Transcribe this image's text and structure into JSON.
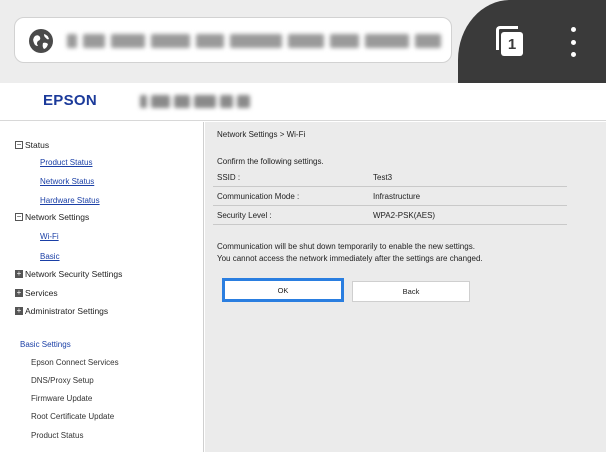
{
  "browser": {
    "tab_count": "1"
  },
  "site": {
    "logo": "EPSON"
  },
  "sidebar": {
    "status": "Status",
    "product_status_link": "Product Status",
    "network_status_link": "Network Status",
    "hardware_status_link": "Hardware Status",
    "network_settings": "Network Settings",
    "wifi_link": "Wi-Fi",
    "basic_link": "Basic",
    "network_security": "Network Security Settings",
    "services": "Services",
    "administrator": "Administrator Settings",
    "basic_settings_heading": "Basic Settings",
    "basic_items": [
      "Epson Connect Services",
      "DNS/Proxy Setup",
      "Firmware Update",
      "Root Certificate Update",
      "Product Status"
    ]
  },
  "main": {
    "breadcrumb": "Network Settings > Wi-Fi",
    "confirm_text": "Confirm the following settings.",
    "settings": [
      {
        "label": "SSID :",
        "value": "Test3"
      },
      {
        "label": "Communication Mode :",
        "value": "Infrastructure"
      },
      {
        "label": "Security Level :",
        "value": "WPA2-PSK(AES)"
      }
    ],
    "note_line1": "Communication will be shut down temporarily to enable the new settings.",
    "note_line2": "You cannot access the network immediately after the settings are changed.",
    "ok_label": "OK",
    "back_label": "Back"
  },
  "colors": {
    "link": "#1a3fa6",
    "logo": "#1b3a9a",
    "focus_border": "#2a7ee0",
    "content_bg": "#ebebeb",
    "chrome_dark": "#3a3a3a"
  }
}
